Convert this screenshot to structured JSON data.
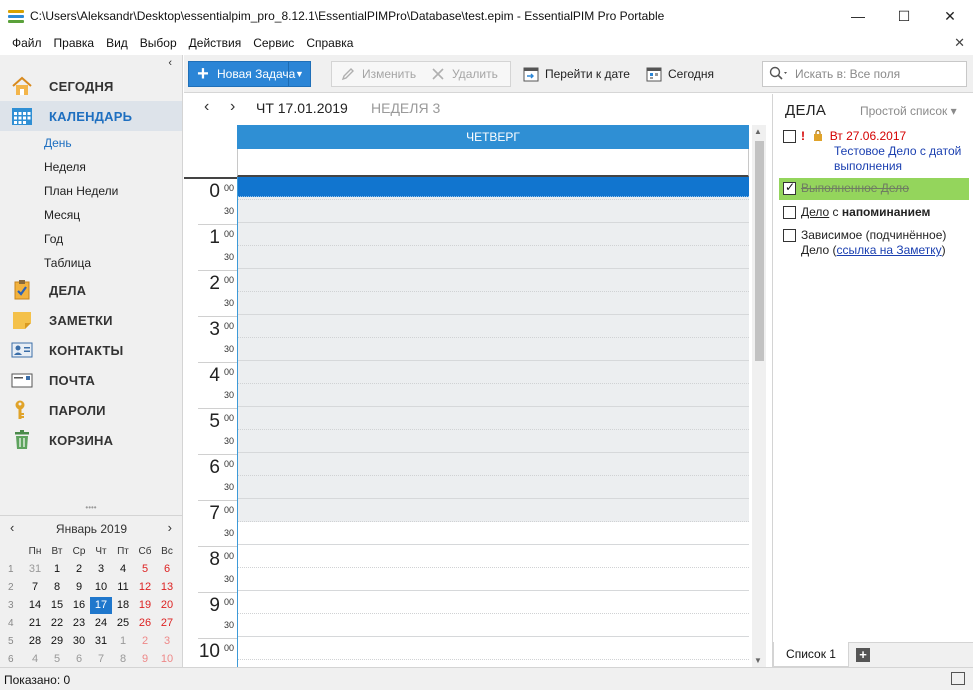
{
  "window": {
    "title": "C:\\Users\\Aleksandr\\Desktop\\essentialpim_pro_8.12.1\\EssentialPIMPro\\Database\\test.epim - EssentialPIM Pro Portable",
    "minimize": "—",
    "maximize": "☐",
    "close": "✕"
  },
  "menu": {
    "items": [
      "Файл",
      "Правка",
      "Вид",
      "Выбор",
      "Действия",
      "Сервис",
      "Справка"
    ],
    "close_icon": "✕"
  },
  "nav": {
    "collapse": "‹",
    "items": [
      {
        "label": "СЕГОДНЯ",
        "icon": "home-icon"
      },
      {
        "label": "КАЛЕНДАРЬ",
        "icon": "calendar-icon"
      },
      {
        "label": "ДЕЛА",
        "icon": "tasks-icon"
      },
      {
        "label": "ЗАМЕТКИ",
        "icon": "notes-icon"
      },
      {
        "label": "КОНТАКТЫ",
        "icon": "contacts-icon"
      },
      {
        "label": "ПОЧТА",
        "icon": "mail-icon"
      },
      {
        "label": "ПАРОЛИ",
        "icon": "key-icon"
      },
      {
        "label": "КОРЗИНА",
        "icon": "trash-icon"
      }
    ],
    "calendar_views": [
      "День",
      "Неделя",
      "План Недели",
      "Месяц",
      "Год",
      "Таблица"
    ],
    "splitter": "••••"
  },
  "minical": {
    "title": "Январь  2019",
    "prev": "‹",
    "next": "›",
    "dow": [
      "Пн",
      "Вт",
      "Ср",
      "Чт",
      "Пт",
      "Сб",
      "Вс"
    ],
    "weeks": [
      {
        "wk": "1",
        "days": [
          "31",
          "1",
          "2",
          "3",
          "4",
          "5",
          "6"
        ]
      },
      {
        "wk": "2",
        "days": [
          "7",
          "8",
          "9",
          "10",
          "11",
          "12",
          "13"
        ]
      },
      {
        "wk": "3",
        "days": [
          "14",
          "15",
          "16",
          "17",
          "18",
          "19",
          "20"
        ]
      },
      {
        "wk": "4",
        "days": [
          "21",
          "22",
          "23",
          "24",
          "25",
          "26",
          "27"
        ]
      },
      {
        "wk": "5",
        "days": [
          "28",
          "29",
          "30",
          "31",
          "1",
          "2",
          "3"
        ]
      },
      {
        "wk": "6",
        "days": [
          "4",
          "5",
          "6",
          "7",
          "8",
          "9",
          "10"
        ]
      }
    ],
    "today": "17"
  },
  "toolbar": {
    "new_task": "Новая Задача",
    "new_task_plus": "+",
    "dropdown": "▼",
    "edit": "Изменить",
    "delete": "Удалить",
    "goto_date": "Перейти к дате",
    "today": "Сегодня"
  },
  "search": {
    "placeholder": "Искать в: Все поля",
    "icon": "search-icon"
  },
  "calendar": {
    "prev": "‹",
    "next": "›",
    "date": "ЧТ 17.01.2019",
    "week": "НЕДЕЛЯ 3",
    "column_header": "ЧЕТВЕРГ",
    "hours": [
      "0",
      "1",
      "2",
      "3",
      "4",
      "5",
      "6",
      "7",
      "8",
      "9",
      "10"
    ],
    "minute_top": "00",
    "minute_half": "30"
  },
  "tasks": {
    "title": "ДЕЛА",
    "view": "Простой список",
    "view_arrow": "▾",
    "items": [
      {
        "priority": "!",
        "date": "Вт 27.06.2017",
        "text": "Тестовое Дело с датой выполнения",
        "checked": false
      },
      {
        "text": "Выполненное Дело",
        "checked": true
      },
      {
        "prefix": "Дело",
        "mid": " с ",
        "bold": "напоминанием",
        "checked": false
      },
      {
        "text": "Зависимое (подчинённое) Дело (",
        "link": "ссылка на Заметку",
        "suffix": ")",
        "checked": false
      }
    ],
    "tab": "Список 1",
    "add": "+"
  },
  "status": {
    "text": "Показано: 0"
  }
}
